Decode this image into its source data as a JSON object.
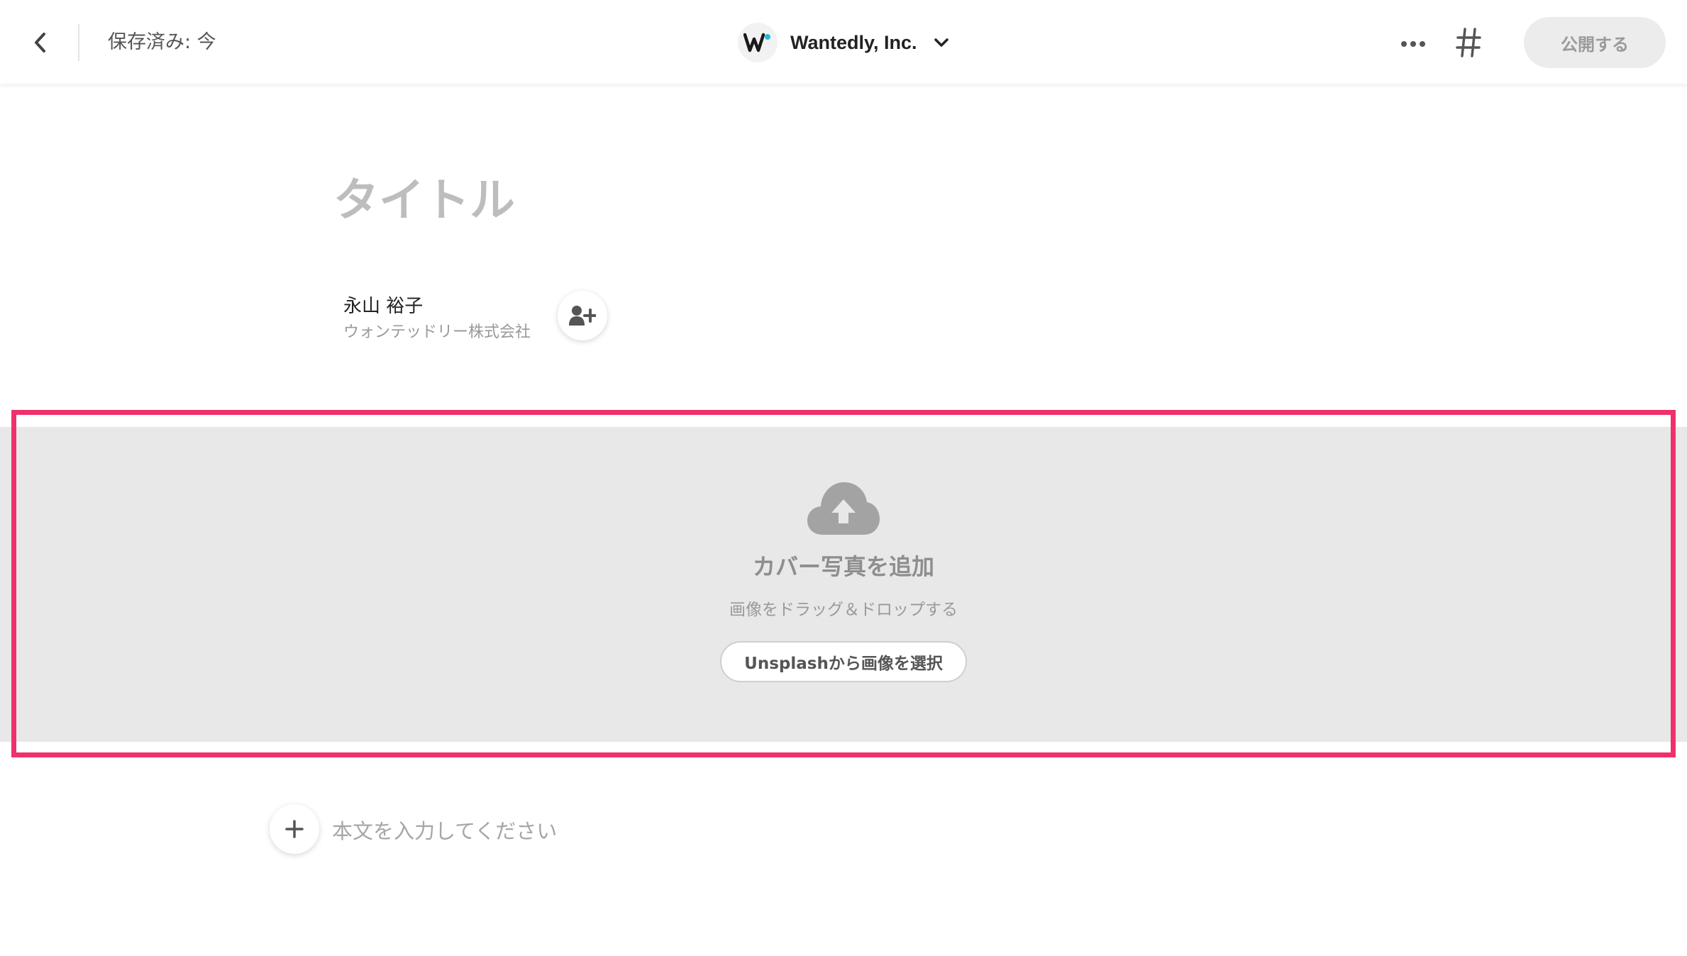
{
  "header": {
    "back_icon": "chevron-left-icon",
    "saved_status": "保存済み: 今",
    "company": {
      "name": "Wantedly, Inc.",
      "logo_icon": "wantedly-logo-icon",
      "dropdown_icon": "chevron-down-icon"
    },
    "more_icon": "more-horizontal-icon",
    "hash_icon": "hashtag-icon",
    "publish_label": "公開する"
  },
  "editor": {
    "title_placeholder": "タイトル",
    "author": {
      "name": "永山 裕子",
      "company": "ウォンテッドリー株式会社",
      "add_icon": "add-user-icon"
    },
    "cover": {
      "icon": "cloud-upload-icon",
      "title": "カバー写真を追加",
      "subtitle": "画像をドラッグ＆ドロップする",
      "unsplash_label": "Unsplashから画像を選択"
    },
    "body_placeholder": "本文を入力してください",
    "add_block_icon": "plus-icon"
  },
  "colors": {
    "highlight": "#f0306c",
    "cover_background": "#e8e8e8",
    "wantedly_accent": "#21bddb"
  }
}
